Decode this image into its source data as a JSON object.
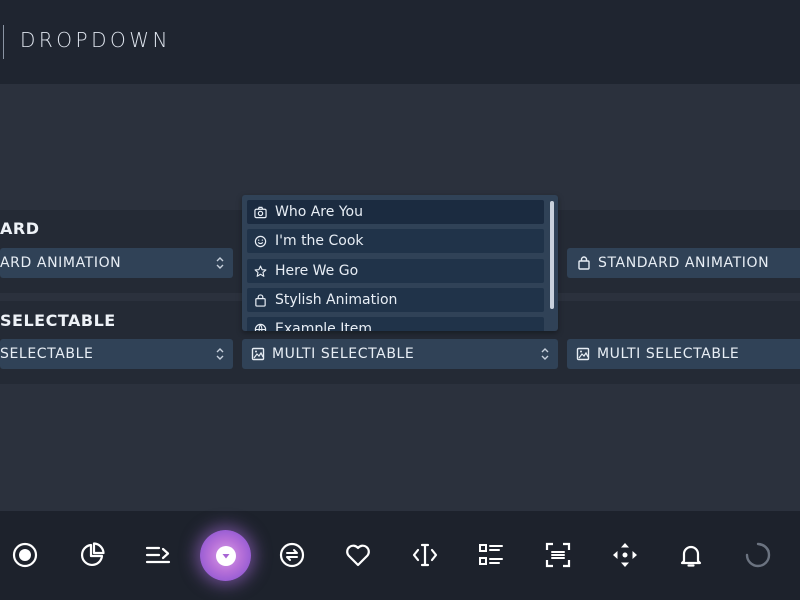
{
  "header": {
    "title": "DROPDOWN"
  },
  "sections": [
    {
      "title": "ARD",
      "left_select": "ARD ANIMATION",
      "right_select": "STANDARD ANIMATION"
    },
    {
      "title": "SELECTABLE",
      "left_select": "SELECTABLE",
      "middle_select": "MULTI SELECTABLE",
      "right_select": "MULTI SELECTABLE"
    }
  ],
  "dropdown": {
    "items": [
      {
        "label": "Who Are You",
        "icon": "camera-icon"
      },
      {
        "label": "I'm the Cook",
        "icon": "smile-icon"
      },
      {
        "label": "Here We Go",
        "icon": "star-icon"
      },
      {
        "label": "Stylish Animation",
        "icon": "bag-icon"
      },
      {
        "label": "Example Item",
        "icon": "globe-icon"
      }
    ]
  },
  "nav": {
    "items": [
      "record-icon",
      "pie-chart-icon",
      "menu-arrow-icon",
      "dropdown-icon",
      "swap-icon",
      "heart-icon",
      "text-cursor-icon",
      "list-icon",
      "scan-icon",
      "move-icon",
      "bell-icon",
      "loader-icon"
    ],
    "active": "dropdown-icon"
  },
  "colors": {
    "accent": "#b56fd8",
    "background": "#2b313d",
    "panel": "#304257",
    "topbar": "#1f2530"
  }
}
